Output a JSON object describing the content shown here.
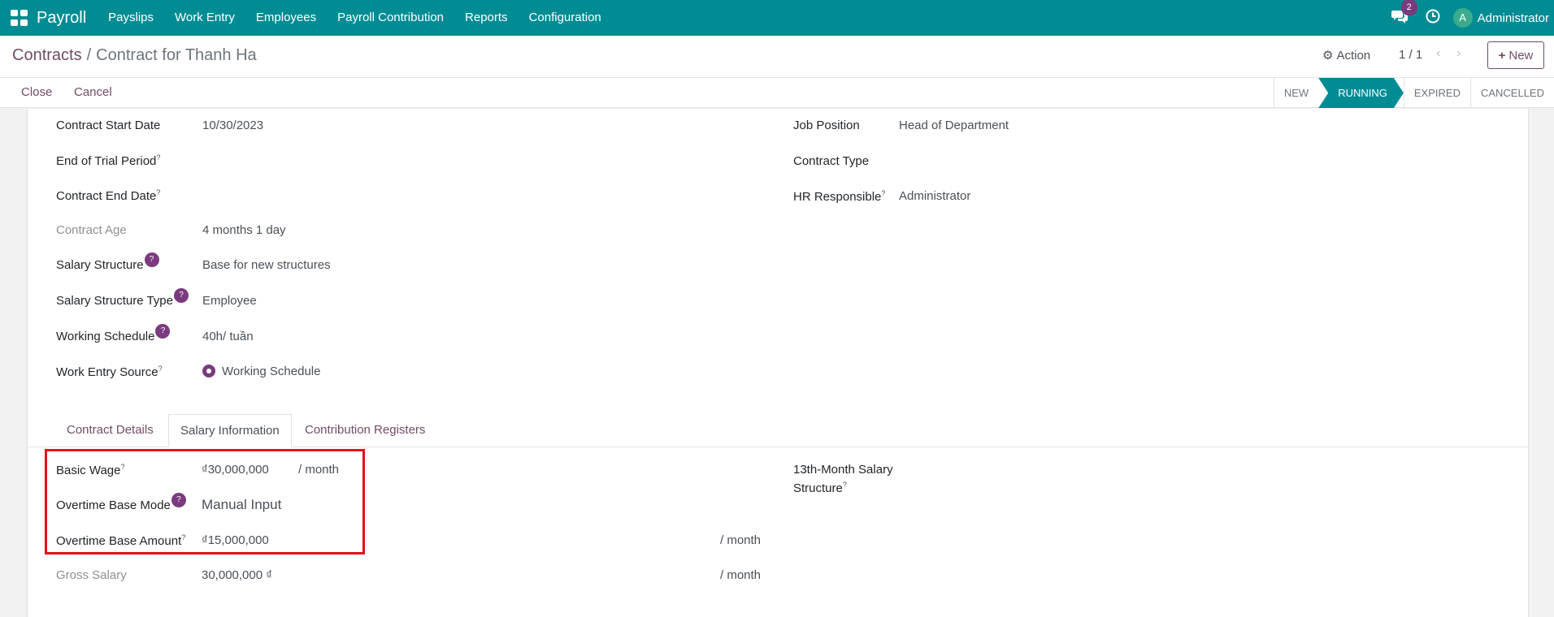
{
  "navbar": {
    "app_name": "Payroll",
    "menu": [
      "Payslips",
      "Work Entry",
      "Employees",
      "Payroll Contribution",
      "Reports",
      "Configuration"
    ],
    "chat_count": "2",
    "user_initial": "A",
    "user_name": "Administrator"
  },
  "control": {
    "breadcrumb_parent": "Contracts",
    "breadcrumb_sep": "/",
    "breadcrumb_current": "Contract for Thanh Ha",
    "action_label": "Action",
    "pager": "1 / 1",
    "new_label": "New"
  },
  "statusbar": {
    "close_label": "Close",
    "cancel_label": "Cancel",
    "stages": [
      "NEW",
      "RUNNING",
      "EXPIRED",
      "CANCELLED"
    ],
    "active_stage": "RUNNING"
  },
  "form": {
    "left": {
      "contract_start_label": "Contract Start Date",
      "contract_start_value": "10/30/2023",
      "trial_label": "End of Trial Period",
      "end_date_label": "Contract End Date",
      "age_label": "Contract Age",
      "age_value": "4 months 1 day",
      "structure_label": "Salary Structure",
      "structure_value": "Base for new structures",
      "structure_type_label": "Salary Structure Type",
      "structure_type_value": "Employee",
      "schedule_label": "Working Schedule",
      "schedule_value": "40h/ tuần",
      "entry_source_label": "Work Entry Source",
      "entry_source_value": "Working Schedule"
    },
    "right": {
      "job_label": "Job Position",
      "job_value": "Head of Department",
      "contract_type_label": "Contract Type",
      "hr_label": "HR Responsible",
      "hr_value": "Administrator"
    },
    "help_mark": "?",
    "tooltip_mark": "?"
  },
  "tabs": [
    "Contract Details",
    "Salary Information",
    "Contribution Registers"
  ],
  "active_tab": "Salary Information",
  "salary": {
    "basic_wage_label": "Basic Wage",
    "basic_wage_value": "₫30,000,000",
    "per_month": "/ month",
    "overtime_mode_label": "Overtime Base Mode",
    "overtime_mode_value": "Manual Input",
    "overtime_amount_label": "Overtime Base Amount",
    "overtime_amount_value": "₫15,000,000",
    "gross_label": "Gross Salary",
    "gross_value": "30,000,000 ₫",
    "thirteenth_label_1": "13th-Month Salary",
    "thirteenth_label_2": "Structure"
  },
  "colors": {
    "navbar": "#018c94",
    "brand": "#714b67",
    "help": "#7a3b7e",
    "highlight": "#e0131c"
  }
}
